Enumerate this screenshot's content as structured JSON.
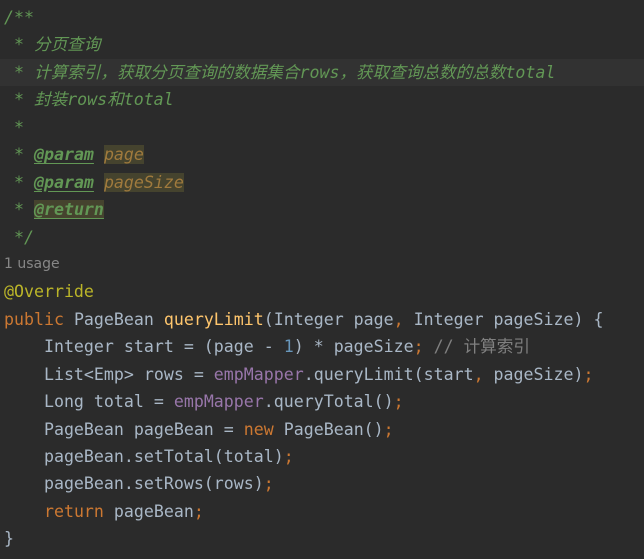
{
  "editor": {
    "theme": {
      "bg": "#2b2b2b",
      "current-line": "#323232",
      "text": "#a9b7c6",
      "doc": "#629755",
      "doc-param": "#a07a3d",
      "warn-bg": "#45432e",
      "annotation": "#bbb529",
      "keyword": "#cc7832",
      "method": "#ffc66d",
      "number": "#6897bb",
      "field": "#9876aa",
      "comment": "#808080",
      "usage": "#878787"
    },
    "lines": [
      {
        "tokens": [
          {
            "k": "doc",
            "v": "/**"
          }
        ]
      },
      {
        "tokens": [
          {
            "k": "doc",
            "v": " * 分页查询"
          }
        ]
      },
      {
        "current": true,
        "tokens": [
          {
            "k": "doc",
            "v": " * 计算索引，获取分页查询的数据集合rows，获取查询总数的总数total"
          }
        ]
      },
      {
        "tokens": [
          {
            "k": "doc",
            "v": " * 封装rows和total"
          }
        ]
      },
      {
        "tokens": [
          {
            "k": "doc",
            "v": " *"
          }
        ]
      },
      {
        "tokens": [
          {
            "k": "doc",
            "v": " * "
          },
          {
            "k": "doctag",
            "v": "@param"
          },
          {
            "k": "doc",
            "v": " "
          },
          {
            "k": "docparam",
            "v": "page",
            "hl": true
          }
        ]
      },
      {
        "tokens": [
          {
            "k": "doc",
            "v": " * "
          },
          {
            "k": "doctag",
            "v": "@param"
          },
          {
            "k": "doc",
            "v": " "
          },
          {
            "k": "docparam",
            "v": "pageSize",
            "hl": true
          }
        ]
      },
      {
        "tokens": [
          {
            "k": "doc",
            "v": " * "
          },
          {
            "k": "doctag",
            "v": "@return",
            "hl": true
          }
        ]
      },
      {
        "tokens": [
          {
            "k": "doc",
            "v": " */"
          }
        ]
      },
      {
        "usage": "1 usage"
      },
      {
        "tokens": [
          {
            "k": "annotation",
            "v": "@Override"
          }
        ]
      },
      {
        "tokens": [
          {
            "k": "keyword",
            "v": "public"
          },
          {
            "k": "plain",
            "v": " PageBean "
          },
          {
            "k": "method",
            "v": "queryLimit"
          },
          {
            "k": "plain",
            "v": "(Integer page"
          },
          {
            "k": "punct",
            "v": ","
          },
          {
            "k": "plain",
            "v": " Integer pageSize) {"
          }
        ]
      },
      {
        "tokens": [
          {
            "k": "plain",
            "v": "    Integer start = (page - "
          },
          {
            "k": "number",
            "v": "1"
          },
          {
            "k": "plain",
            "v": ") * pageSize"
          },
          {
            "k": "punct",
            "v": ";"
          },
          {
            "k": "comment",
            "v": " // 计算索引"
          }
        ]
      },
      {
        "tokens": [
          {
            "k": "plain",
            "v": "    List<Emp> rows = "
          },
          {
            "k": "field",
            "v": "empMapper"
          },
          {
            "k": "plain",
            "v": ".queryLimit(start"
          },
          {
            "k": "punct",
            "v": ","
          },
          {
            "k": "plain",
            "v": " pageSize)"
          },
          {
            "k": "punct",
            "v": ";"
          }
        ]
      },
      {
        "tokens": [
          {
            "k": "plain",
            "v": "    Long total = "
          },
          {
            "k": "field",
            "v": "empMapper"
          },
          {
            "k": "plain",
            "v": ".queryTotal()"
          },
          {
            "k": "punct",
            "v": ";"
          }
        ]
      },
      {
        "tokens": [
          {
            "k": "plain",
            "v": "    PageBean pageBean = "
          },
          {
            "k": "keyword",
            "v": "new"
          },
          {
            "k": "plain",
            "v": " PageBean()"
          },
          {
            "k": "punct",
            "v": ";"
          }
        ]
      },
      {
        "tokens": [
          {
            "k": "plain",
            "v": "    pageBean.setTotal(total)"
          },
          {
            "k": "punct",
            "v": ";"
          }
        ]
      },
      {
        "tokens": [
          {
            "k": "plain",
            "v": "    pageBean.setRows(rows)"
          },
          {
            "k": "punct",
            "v": ";"
          }
        ]
      },
      {
        "tokens": [
          {
            "k": "plain",
            "v": "    "
          },
          {
            "k": "keyword",
            "v": "return"
          },
          {
            "k": "plain",
            "v": " pageBean"
          },
          {
            "k": "punct",
            "v": ";"
          }
        ]
      },
      {
        "tokens": [
          {
            "k": "plain",
            "v": "}"
          }
        ]
      }
    ]
  }
}
